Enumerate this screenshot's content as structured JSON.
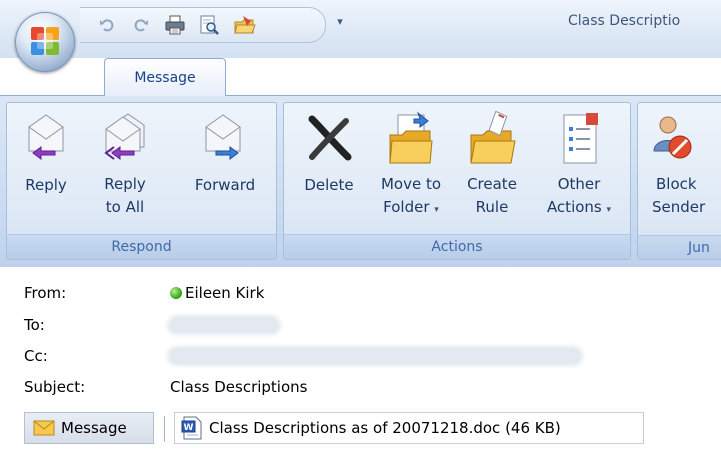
{
  "window": {
    "title": "Class Descriptio"
  },
  "quick_access": {
    "items": [
      "undo-icon",
      "redo-icon",
      "print-icon",
      "print-preview-icon",
      "save-to-folder-icon"
    ],
    "customize_glyph": "▾"
  },
  "tabs": [
    {
      "label": "Message",
      "active": true
    }
  ],
  "ribbon": {
    "groups": [
      {
        "label": "Respond",
        "buttons": [
          {
            "label": "Reply",
            "icon": "reply-icon"
          },
          {
            "label_line1": "Reply",
            "label_line2": "to All",
            "icon": "reply-all-icon"
          },
          {
            "label": "Forward",
            "icon": "forward-icon"
          }
        ]
      },
      {
        "label": "Actions",
        "buttons": [
          {
            "label": "Delete",
            "icon": "delete-icon"
          },
          {
            "label_line1": "Move to",
            "label_line2": "Folder",
            "icon": "move-to-folder-icon",
            "dropdown": "▾"
          },
          {
            "label_line1": "Create",
            "label_line2": "Rule",
            "icon": "create-rule-icon"
          },
          {
            "label_line1": "Other",
            "label_line2": "Actions",
            "icon": "other-actions-icon",
            "dropdown": "▾"
          }
        ]
      },
      {
        "label": "Jun",
        "buttons": [
          {
            "label_line1": "Block",
            "label_line2": "Sender",
            "icon": "block-sender-icon"
          }
        ]
      }
    ]
  },
  "header": {
    "from_label": "From:",
    "from_value": "Eileen Kirk",
    "to_label": "To:",
    "cc_label": "Cc:",
    "subject_label": "Subject:",
    "subject_value": "Class Descriptions"
  },
  "attachments": {
    "message_button_label": "Message",
    "items": [
      {
        "label": "Class Descriptions as of 20071218.doc (46 KB)",
        "icon": "word-document-icon"
      }
    ]
  },
  "colors": {
    "ribbon_bg": "#c9daf0",
    "group_label_text": "#3e6aaa",
    "button_text": "#1e3a64",
    "tab_text": "#15428b",
    "presence_online": "#33a51b"
  }
}
